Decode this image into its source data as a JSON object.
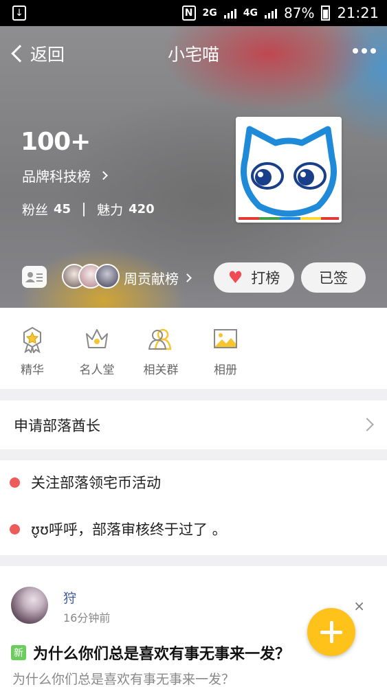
{
  "status_bar": {
    "network_2g": "2G",
    "network_4g": "4G",
    "battery": "87%",
    "time": "21:21"
  },
  "nav": {
    "back_label": "返回",
    "title": "小宅喵"
  },
  "tribe": {
    "rank": "100+",
    "board_link": "品牌科技榜",
    "fans_label": "粉丝",
    "fans_count": "45",
    "charm_label": "魅力",
    "charm_count": "420",
    "logo_icon": "cat-face-logo"
  },
  "actions": {
    "weekly_contrib": "周贡献榜",
    "vote_label": "打榜",
    "signed_label": "已签"
  },
  "menu": {
    "items": [
      {
        "label": "精华",
        "icon": "medal-icon"
      },
      {
        "label": "名人堂",
        "icon": "crown-icon"
      },
      {
        "label": "相关群",
        "icon": "group-icon"
      },
      {
        "label": "相册",
        "icon": "picture-icon"
      }
    ]
  },
  "apply_chief": "申请部落酋长",
  "notices": [
    "关注部落领宅币活动",
    "ʊ̬ʊ呼呼，部落审核终于过了 。"
  ],
  "post": {
    "author": "狩",
    "time": "16分钟前",
    "new_badge": "新",
    "title": "为什么你们总是喜欢有事无事来一发？",
    "preview": "为什么你们总是喜欢有事无事来一发？",
    "close_glyph": "×"
  },
  "colors": {
    "accent_red": "#ee5b5b",
    "fab_yellow": "#ffc21a",
    "author_blue": "#3f5b9d",
    "new_green": "#6ccd5e"
  }
}
